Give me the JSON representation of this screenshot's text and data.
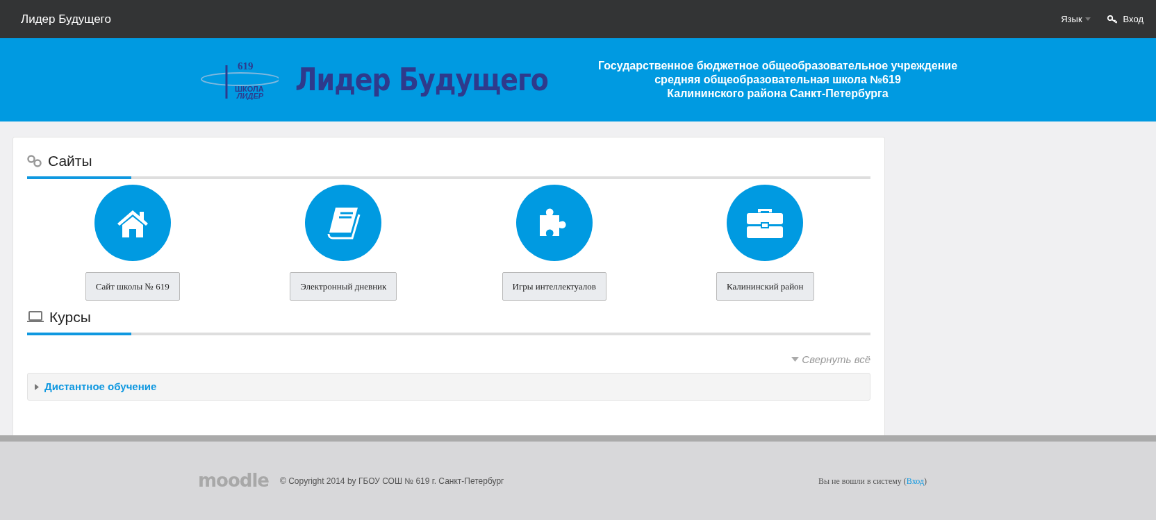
{
  "navbar": {
    "brand": "Лидер Будущего",
    "language_menu": "Язык",
    "login_link": "Вход"
  },
  "banner": {
    "logo_number": "619",
    "logo_line_1": "ШКОЛА",
    "logo_line_2": "ЛИДЕР",
    "logo_title": "Лидер Будущего",
    "institution_lines": [
      "Государственное бюджетное общеобразовательное учреждение",
      "средняя общеобразовательная школа №619",
      "Калининского района Санкт-Петербурга"
    ]
  },
  "sites_section": {
    "title": "Сайты",
    "links": [
      {
        "kind": "house",
        "label": "Сайт школы № 619"
      },
      {
        "kind": "book",
        "label": "Электронный дневник"
      },
      {
        "kind": "puzzle",
        "label": "Игры интеллектуалов"
      },
      {
        "kind": "briefcase",
        "label": "Калининский район"
      }
    ]
  },
  "courses_section": {
    "title": "Курсы",
    "collapse_all": "Свернуть всё",
    "categories": [
      {
        "name": "Дистантное обучение",
        "expanded": false
      }
    ]
  },
  "footer": {
    "logo": "moodle",
    "copyright": "© Copyright 2014 by ГБОУ СОШ № 619 г. Санкт-Петербург",
    "login_info": "Вы не вошли в систему (",
    "login_link": "Вход",
    "login_info_end": ")"
  }
}
